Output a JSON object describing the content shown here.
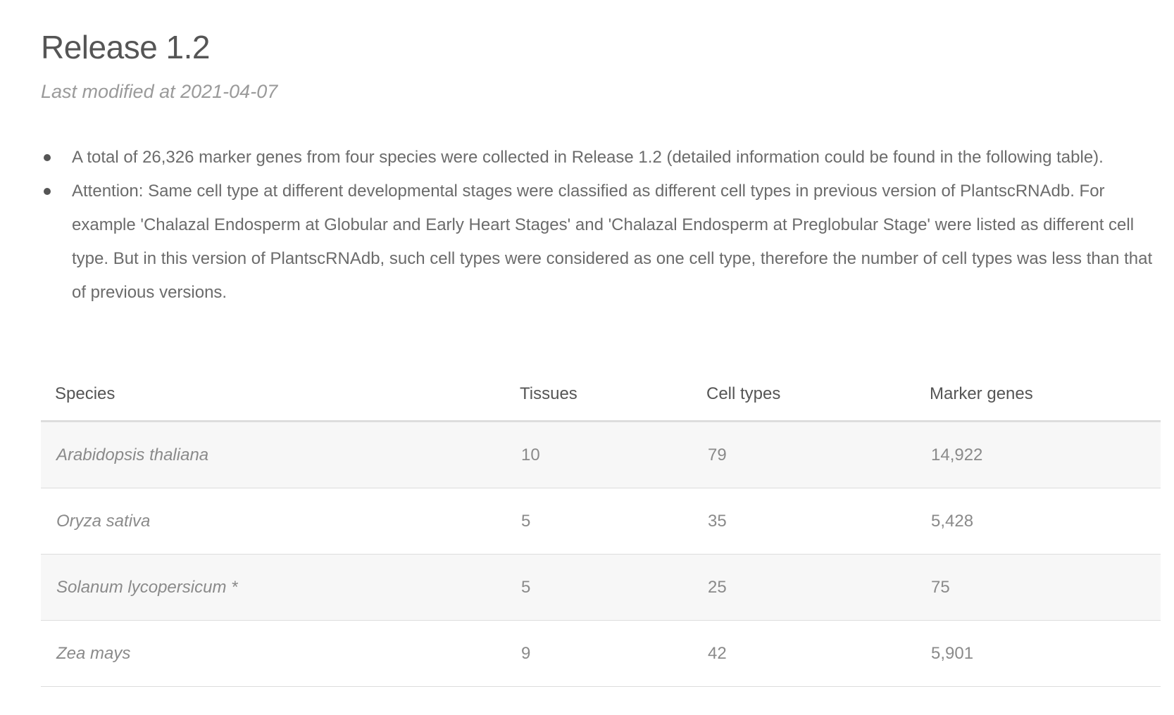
{
  "release": {
    "title": "Release 1.2",
    "modified": "Last modified at 2021-04-07"
  },
  "notes": [
    "A total of 26,326 marker genes from four species were collected in Release 1.2 (detailed information could be found in the following table).",
    "Attention: Same cell type at different developmental stages were classified as different cell types in previous version of PlantscRNAdb. For example 'Chalazal Endosperm at Globular and Early Heart Stages' and 'Chalazal Endosperm at Preglobular Stage' were listed as different cell type. But in this version of PlantscRNAdb, such cell types were considered as one cell type, therefore the number of cell types was less than that of previous versions."
  ],
  "table": {
    "headers": {
      "species": "Species",
      "tissues": "Tissues",
      "cell_types": "Cell types",
      "marker_genes": "Marker genes"
    },
    "rows": [
      {
        "species": "Arabidopsis thaliana",
        "tissues": "10",
        "cell_types": "79",
        "marker_genes": "14,922"
      },
      {
        "species": "Oryza sativa",
        "tissues": "5",
        "cell_types": "35",
        "marker_genes": "5,428"
      },
      {
        "species": "Solanum lycopersicum *",
        "tissues": "5",
        "cell_types": "25",
        "marker_genes": "75"
      },
      {
        "species": "Zea mays",
        "tissues": "9",
        "cell_types": "42",
        "marker_genes": "5,901"
      }
    ]
  },
  "colors": {
    "title": "#555555",
    "text": "#6b6b6b",
    "stripe": "#f7f7f7",
    "border": "#dddddd"
  }
}
